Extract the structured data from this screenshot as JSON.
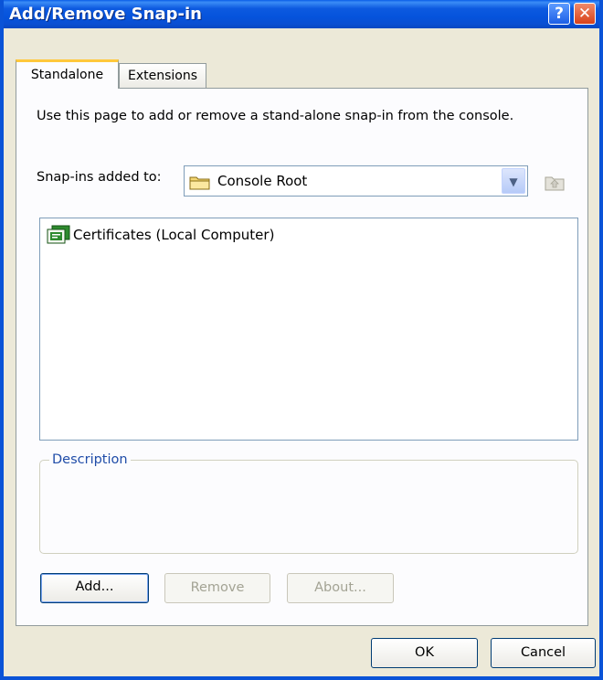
{
  "window": {
    "title": "Add/Remove Snap-in",
    "help_label": "?",
    "close_label": "✕"
  },
  "tabs": [
    {
      "label": "Standalone"
    },
    {
      "label": "Extensions"
    }
  ],
  "standalone": {
    "intro": "Use this page to add or remove a stand-alone snap-in from the console.",
    "snapins_label": "Snap-ins added to:",
    "combo_value": "Console Root",
    "list_items": [
      {
        "label": "Certificates (Local Computer)",
        "icon": "certificates-icon"
      }
    ],
    "description_label": "Description"
  },
  "buttons": {
    "add": "Add...",
    "remove": "Remove",
    "about": "About...",
    "ok": "OK",
    "cancel": "Cancel"
  },
  "colors": {
    "title_bar": "#0a53d7",
    "dialog_bg": "#ece9d8",
    "active_tab_accent": "#ffc83c"
  }
}
